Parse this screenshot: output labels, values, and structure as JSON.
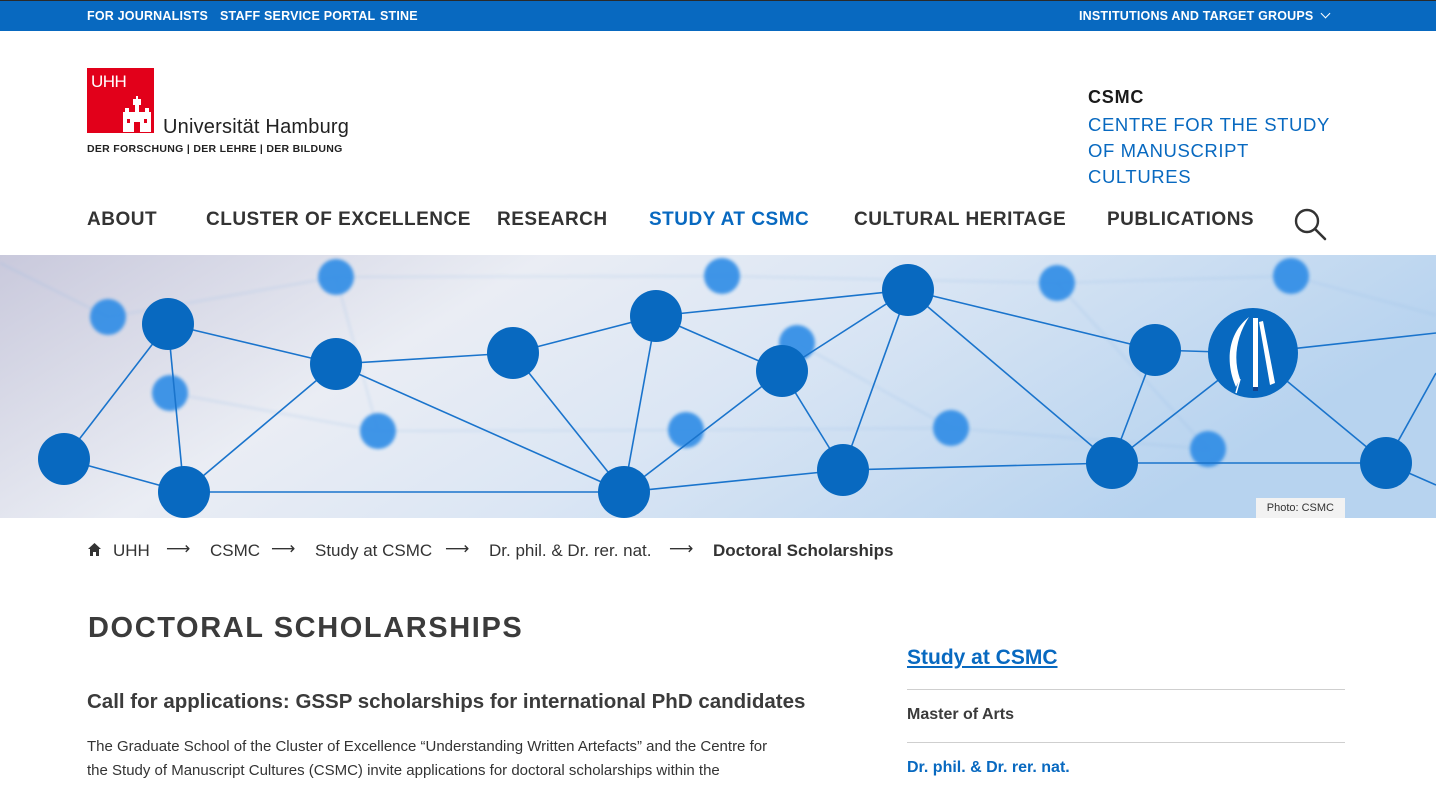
{
  "topbar": {
    "links": [
      "FOR JOURNALISTS",
      "STAFF SERVICE PORTAL",
      "STINE"
    ],
    "right_menu": "INSTITUTIONS AND TARGET GROUPS"
  },
  "header": {
    "logo_mark": "UHH",
    "logo_name": "Universität Hamburg",
    "logo_tagline": "DER FORSCHUNG | DER LEHRE | DER BILDUNG",
    "site_short": "CSMC",
    "site_long": "CENTRE FOR THE STUDY OF MANUSCRIPT CULTURES"
  },
  "nav": {
    "items": [
      "ABOUT",
      "CLUSTER OF EXCELLENCE",
      "RESEARCH",
      "STUDY AT CSMC",
      "CULTURAL HERITAGE",
      "PUBLICATIONS"
    ],
    "active": "STUDY AT CSMC"
  },
  "hero": {
    "photo_credit": "Photo: CSMC"
  },
  "breadcrumb": {
    "items": [
      "UHH",
      "CSMC",
      "Study at CSMC",
      "Dr. phil. & Dr. rer. nat.",
      "Doctoral Scholarships"
    ],
    "separator": "⟶"
  },
  "main": {
    "title": "DOCTORAL SCHOLARSHIPS",
    "subheading": "Call for applications: GSSP scholarships for international PhD candidates",
    "body": "The Graduate School of the Cluster of Excellence “Understanding Written Artefacts” and the Centre for the Study of Manuscript Cultures (CSMC) invite applications for doctoral scholarships within the"
  },
  "sidebar": {
    "title": "Study at CSMC",
    "items": [
      "Master of Arts",
      "Dr. phil. & Dr. rer. nat."
    ],
    "active_index": 1
  },
  "colors": {
    "brand_blue": "#0869c0",
    "uhh_red": "#e2001a"
  }
}
